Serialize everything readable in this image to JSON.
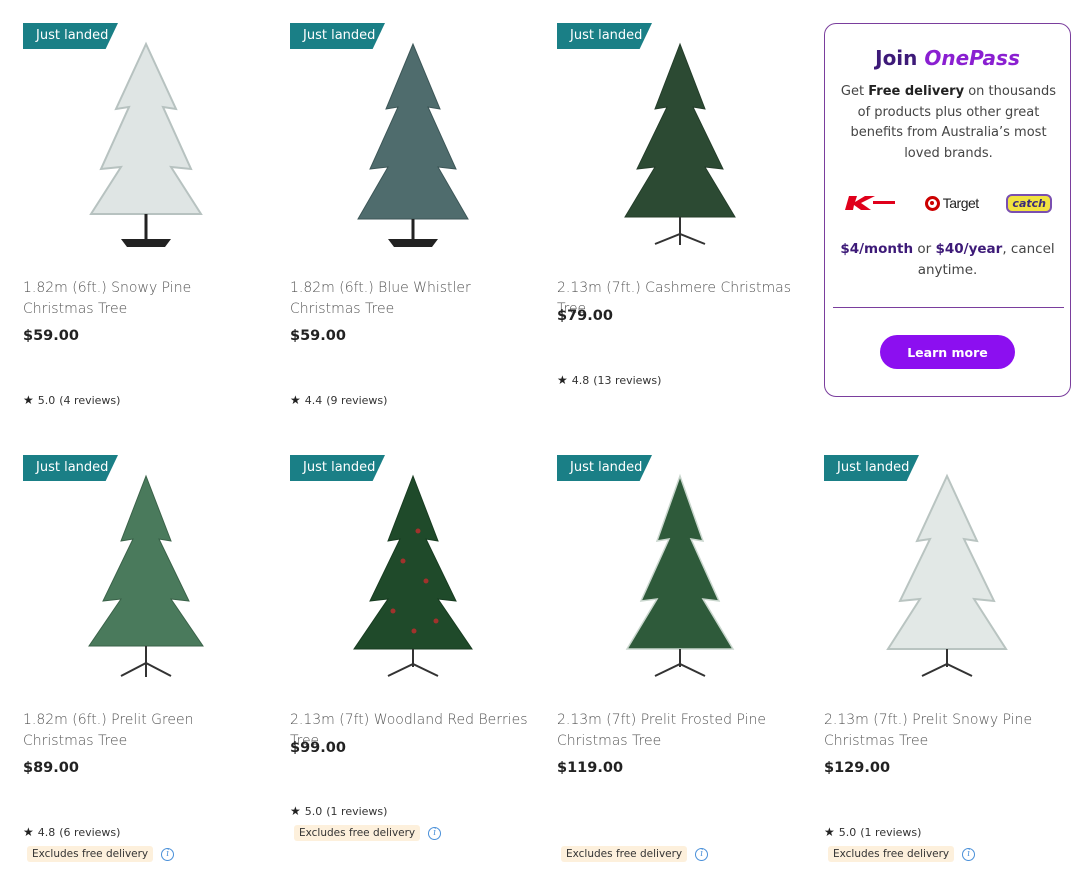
{
  "products": [
    {
      "badge": "Just landed",
      "title": "1.82m (6ft.) Snowy Pine Christmas Tree",
      "price": "$59.00",
      "rating": "5.0",
      "reviews": "(4 reviews)",
      "excludes": ""
    },
    {
      "badge": "Just landed",
      "title": "1.82m (6ft.) Blue Whistler Christmas Tree",
      "price": "$59.00",
      "rating": "4.4",
      "reviews": "(9 reviews)",
      "excludes": ""
    },
    {
      "badge": "Just landed",
      "title": "2.13m (7ft.) Cashmere Christmas Tree",
      "price": "$79.00",
      "rating": "4.8",
      "reviews": "(13 reviews)",
      "excludes": ""
    },
    {
      "badge": "Just landed",
      "title": "1.82m (6ft.) Prelit Green Christmas Tree",
      "price": "$89.00",
      "rating": "4.8",
      "reviews": "(6 reviews)",
      "excludes": "Excludes free delivery"
    },
    {
      "badge": "Just landed",
      "title": "2.13m (7ft) Woodland Red Berries Tree",
      "price": "$99.00",
      "rating": "5.0",
      "reviews": "(1 reviews)",
      "excludes": "Excludes free delivery"
    },
    {
      "badge": "Just landed",
      "title": "2.13m (7ft) Prelit Frosted Pine Christmas Tree",
      "price": "$119.00",
      "rating": "",
      "reviews": "",
      "excludes": "Excludes free delivery"
    },
    {
      "badge": "Just landed",
      "title": "2.13m (7ft.) Prelit Snowy Pine Christmas Tree",
      "price": "$129.00",
      "rating": "5.0",
      "reviews": "(1 reviews)",
      "excludes": "Excludes free delivery"
    }
  ],
  "onepass": {
    "join": "Join",
    "brand": "OnePass",
    "text_1": "Get ",
    "text_bold": "Free delivery",
    "text_2": " on thousands of products plus other great benefits from Australia’s most loved brands.",
    "logo_kmart": "Kmart",
    "logo_target": "Target",
    "logo_catch": "catch",
    "price_month": "$4/month",
    "price_or": " or ",
    "price_year": "$40/year",
    "price_tail": ", cancel anytime.",
    "button": "Learn more"
  },
  "colors": {
    "badge": "#1a7f86",
    "onepass_purple": "#3d1a78",
    "button": "#8c0ff0",
    "snowy": "#dfe5e4",
    "blue_green": "#4f6c6d",
    "dark_green": "#2c4a33",
    "green": "#4a7a5c",
    "deep_green": "#1f4a2a",
    "berry": "#a1322c"
  }
}
